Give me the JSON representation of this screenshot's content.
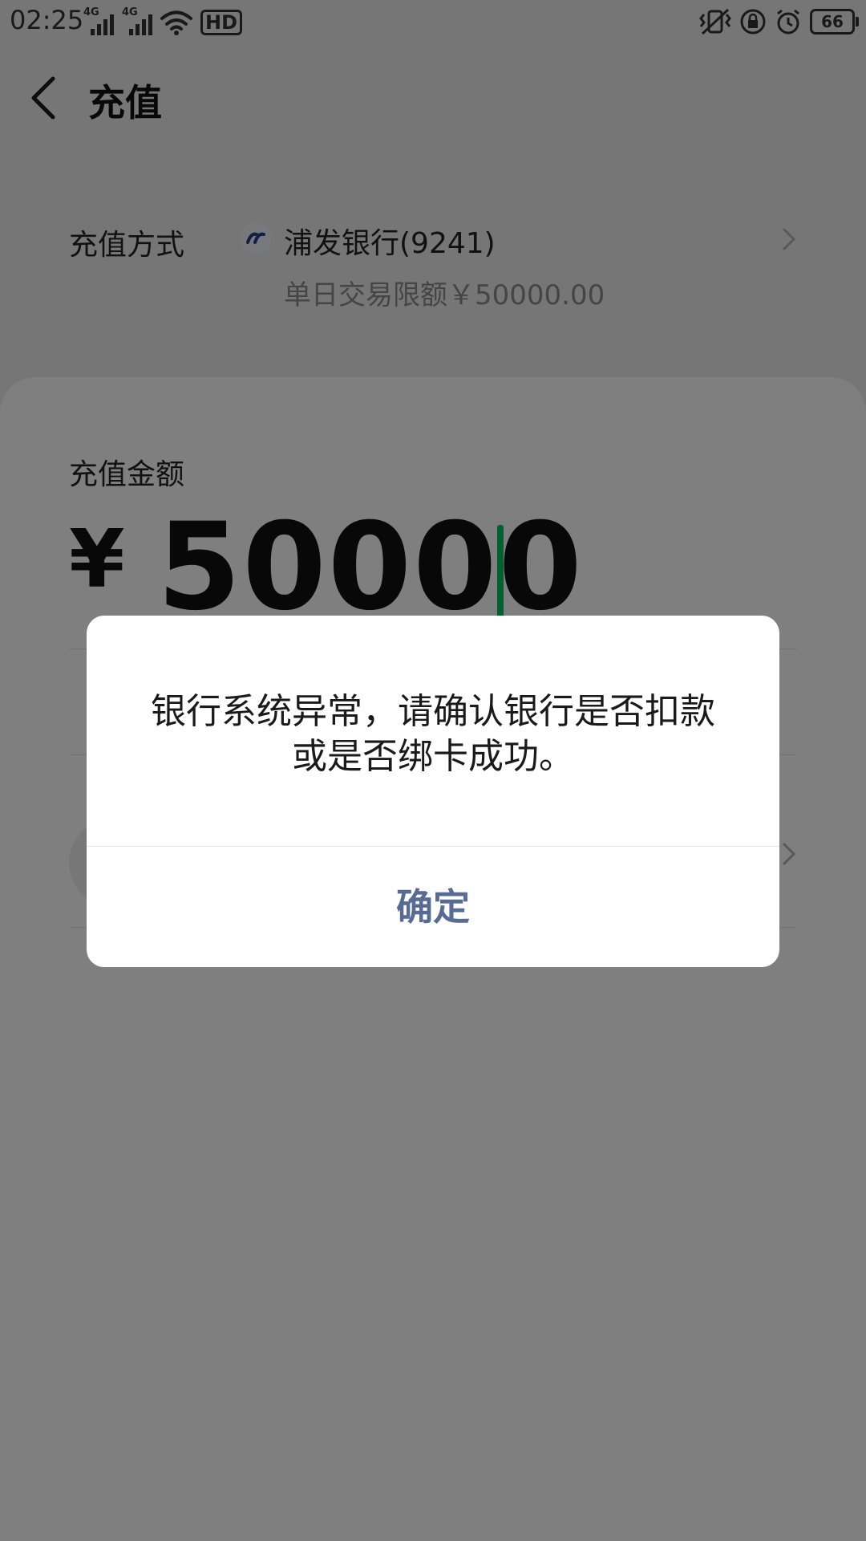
{
  "status_bar": {
    "time": "02:25",
    "net_1": "4G",
    "net_2": "4G",
    "hd": "HD",
    "battery": "66"
  },
  "header": {
    "title": "充值"
  },
  "method": {
    "label": "充值方式",
    "bank_name": "浦发银行(9241)",
    "limit": "单日交易限额￥50000.00"
  },
  "amount": {
    "label": "充值金额",
    "currency": "¥",
    "value": "50000"
  },
  "dialog": {
    "line1": "银行系统异常，请确认银行是否扣款",
    "line2": "或是否绑卡成功。",
    "confirm": "确定"
  },
  "colors": {
    "cursor": "#07c160",
    "dialog_button": "#576b95"
  }
}
